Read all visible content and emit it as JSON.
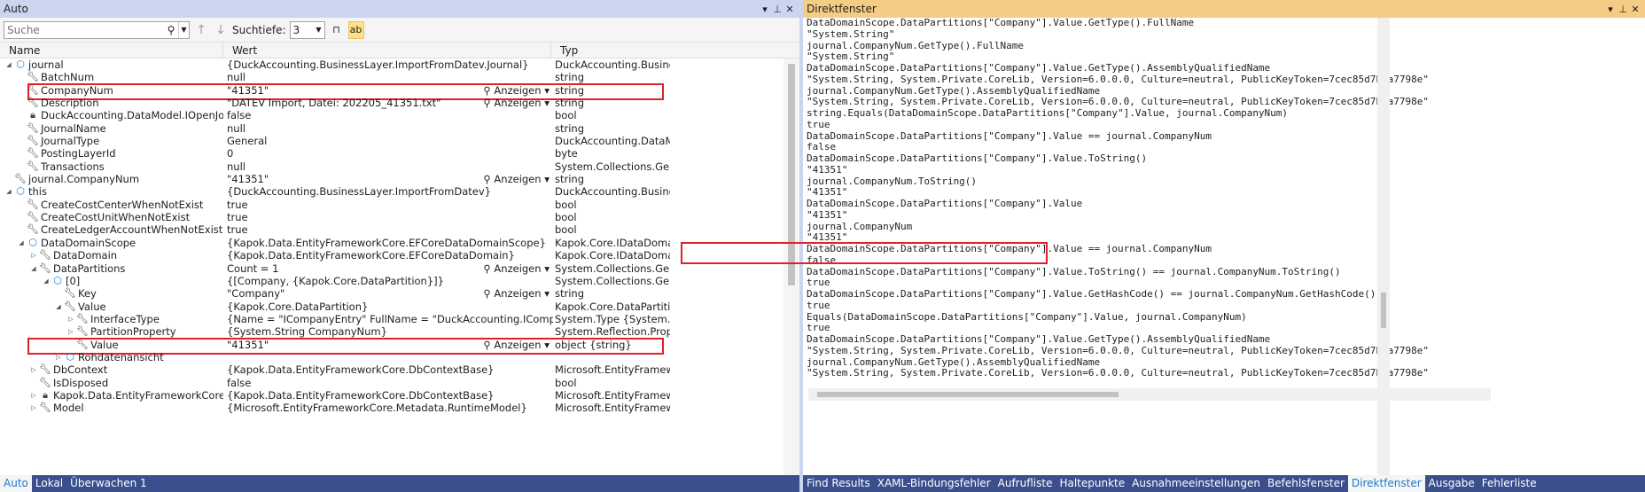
{
  "auto": {
    "title": "Auto",
    "search_placeholder": "Suche",
    "depth_label": "Suchtiefe:",
    "depth_value": "3",
    "columns": {
      "name": "Name",
      "value": "Wert",
      "type": "Typ"
    },
    "view_label": "Anzeigen",
    "rows": [
      {
        "indent": 0,
        "exp": "open",
        "icon": "obj",
        "name": "journal",
        "value": "{DuckAccounting.BusinessLayer.ImportFromDatev.Journal}",
        "type": "DuckAccounting.Busine..."
      },
      {
        "indent": 1,
        "exp": "",
        "icon": "wrench",
        "name": "BatchNum",
        "value": "null",
        "type": "string"
      },
      {
        "indent": 1,
        "exp": "",
        "icon": "wrench",
        "name": "CompanyNum",
        "value": "\"41351\"",
        "type": "string",
        "view": true,
        "hl": true
      },
      {
        "indent": 1,
        "exp": "",
        "icon": "wrench",
        "name": "Description",
        "value": "\"DATEV Import, Datei: 202205_41351.txt\"",
        "type": "string",
        "view": true
      },
      {
        "indent": 1,
        "exp": "",
        "icon": "lock",
        "name": "DuckAccounting.DataModel.IOpenJournal...",
        "value": "false",
        "type": "bool"
      },
      {
        "indent": 1,
        "exp": "",
        "icon": "wrench",
        "name": "JournalName",
        "value": "null",
        "type": "string"
      },
      {
        "indent": 1,
        "exp": "",
        "icon": "wrench",
        "name": "JournalType",
        "value": "General",
        "type": "DuckAccounting.DataM..."
      },
      {
        "indent": 1,
        "exp": "",
        "icon": "wrench",
        "name": "PostingLayerId",
        "value": "0",
        "type": "byte"
      },
      {
        "indent": 1,
        "exp": "",
        "icon": "wrench",
        "name": "Transactions",
        "value": "null",
        "type": "System.Collections.Gene..."
      },
      {
        "indent": 0,
        "exp": "",
        "icon": "wrench",
        "name": "journal.CompanyNum",
        "value": "\"41351\"",
        "type": "string",
        "view": true
      },
      {
        "indent": 0,
        "exp": "open",
        "icon": "obj",
        "name": "this",
        "value": "{DuckAccounting.BusinessLayer.ImportFromDatev}",
        "type": "DuckAccounting.Busine..."
      },
      {
        "indent": 1,
        "exp": "",
        "icon": "wrench",
        "name": "CreateCostCenterWhenNotExist",
        "value": "true",
        "type": "bool"
      },
      {
        "indent": 1,
        "exp": "",
        "icon": "wrench",
        "name": "CreateCostUnitWhenNotExist",
        "value": "true",
        "type": "bool"
      },
      {
        "indent": 1,
        "exp": "",
        "icon": "wrench",
        "name": "CreateLedgerAccountWhenNotExist",
        "value": "true",
        "type": "bool"
      },
      {
        "indent": 1,
        "exp": "open",
        "icon": "obj",
        "name": "DataDomainScope",
        "value": "{Kapok.Data.EntityFrameworkCore.EFCoreDataDomainScope}",
        "type": "Kapok.Core.IDataDomai..."
      },
      {
        "indent": 2,
        "exp": "closed",
        "icon": "wrench",
        "name": "DataDomain",
        "value": "{Kapok.Data.EntityFrameworkCore.EFCoreDataDomain}",
        "type": "Kapok.Core.IDataDomai..."
      },
      {
        "indent": 2,
        "exp": "open",
        "icon": "wrench",
        "name": "DataPartitions",
        "value": "Count = 1",
        "type": "System.Collections.Gene...",
        "view": true
      },
      {
        "indent": 3,
        "exp": "open",
        "icon": "obj",
        "name": "[0]",
        "value": "{[Company, {Kapok.Core.DataPartition}]}",
        "type": "System.Collections.Gene..."
      },
      {
        "indent": 4,
        "exp": "",
        "icon": "wrench",
        "name": "Key",
        "value": "\"Company\"",
        "type": "string",
        "view": true
      },
      {
        "indent": 4,
        "exp": "open",
        "icon": "wrench",
        "name": "Value",
        "value": "{Kapok.Core.DataPartition}",
        "type": "Kapok.Core.DataPartition"
      },
      {
        "indent": 5,
        "exp": "closed",
        "icon": "wrench",
        "name": "InterfaceType",
        "value": "{Name = \"ICompanyEntry\" FullName = \"DuckAccounting.ICompanyEntry\"}",
        "type": "System.Type {System.Ru..."
      },
      {
        "indent": 5,
        "exp": "closed",
        "icon": "wrench",
        "name": "PartitionProperty",
        "value": "{System.String CompanyNum}",
        "type": "System.Reflection.Prope..."
      },
      {
        "indent": 5,
        "exp": "",
        "icon": "wrench",
        "name": "Value",
        "value": "\"41351\"",
        "type": "object {string}",
        "view": true,
        "hl": true
      },
      {
        "indent": 4,
        "exp": "closed",
        "icon": "obj",
        "name": "Rohdatenansicht",
        "value": "",
        "type": ""
      },
      {
        "indent": 2,
        "exp": "closed",
        "icon": "wrench",
        "name": "DbContext",
        "value": "{Kapok.Data.EntityFrameworkCore.DbContextBase}",
        "type": "Microsoft.EntityFramew..."
      },
      {
        "indent": 2,
        "exp": "",
        "icon": "wrench",
        "name": "IsDisposed",
        "value": "false",
        "type": "bool"
      },
      {
        "indent": 2,
        "exp": "closed",
        "icon": "lock",
        "name": "Kapok.Data.EntityFrameworkCore.IEntit...",
        "value": "{Kapok.Data.EntityFrameworkCore.DbContextBase}",
        "type": "Microsoft.EntityFramew..."
      },
      {
        "indent": 2,
        "exp": "closed",
        "icon": "wrench",
        "name": "Model",
        "value": "{Microsoft.EntityFrameworkCore.Metadata.RuntimeModel}",
        "type": "Microsoft.EntityFramew..."
      }
    ],
    "bottom_tabs": [
      "Auto",
      "Lokal",
      "Überwachen 1"
    ]
  },
  "immediate": {
    "title": "Direktfenster",
    "lines": [
      "DataDomainScope.DataPartitions[\"Company\"].Value.GetType().FullName",
      "\"System.String\"",
      "journal.CompanyNum.GetType().FullName",
      "\"System.String\"",
      "DataDomainScope.DataPartitions[\"Company\"].Value.GetType().AssemblyQualifiedName",
      "\"System.String, System.Private.CoreLib, Version=6.0.0.0, Culture=neutral, PublicKeyToken=7cec85d7bea7798e\"",
      "journal.CompanyNum.GetType().AssemblyQualifiedName",
      "\"System.String, System.Private.CoreLib, Version=6.0.0.0, Culture=neutral, PublicKeyToken=7cec85d7bea7798e\"",
      "string.Equals(DataDomainScope.DataPartitions[\"Company\"].Value, journal.CompanyNum)",
      "true",
      "DataDomainScope.DataPartitions[\"Company\"].Value == journal.CompanyNum",
      "false",
      "DataDomainScope.DataPartitions[\"Company\"].Value.ToString()",
      "\"41351\"",
      "journal.CompanyNum.ToString()",
      "\"41351\"",
      "DataDomainScope.DataPartitions[\"Company\"].Value",
      "\"41351\"",
      "journal.CompanyNum",
      "\"41351\"",
      "DataDomainScope.DataPartitions[\"Company\"].Value == journal.CompanyNum",
      "false",
      "DataDomainScope.DataPartitions[\"Company\"].Value.ToString() == journal.CompanyNum.ToString()",
      "true",
      "DataDomainScope.DataPartitions[\"Company\"].Value.GetHashCode() == journal.CompanyNum.GetHashCode()",
      "true",
      "Equals(DataDomainScope.DataPartitions[\"Company\"].Value, journal.CompanyNum)",
      "true",
      "DataDomainScope.DataPartitions[\"Company\"].Value.GetType().AssemblyQualifiedName",
      "\"System.String, System.Private.CoreLib, Version=6.0.0.0, Culture=neutral, PublicKeyToken=7cec85d7bea7798e\"",
      "journal.CompanyNum.GetType().AssemblyQualifiedName",
      "\"System.String, System.Private.CoreLib, Version=6.0.0.0, Culture=neutral, PublicKeyToken=7cec85d7bea7798e\""
    ],
    "bottom_tabs": [
      "Find Results",
      "XAML-Bindungsfehler",
      "Aufrufliste",
      "Haltepunkte",
      "Ausnahmeeinstellungen",
      "Befehlsfenster",
      "Direktfenster",
      "Ausgabe",
      "Fehlerliste"
    ],
    "active_tab": "Direktfenster"
  },
  "icons": {
    "dropdown": "chevron-down-icon",
    "pin": "pin-icon",
    "close": "close-icon",
    "search": "search-icon"
  }
}
